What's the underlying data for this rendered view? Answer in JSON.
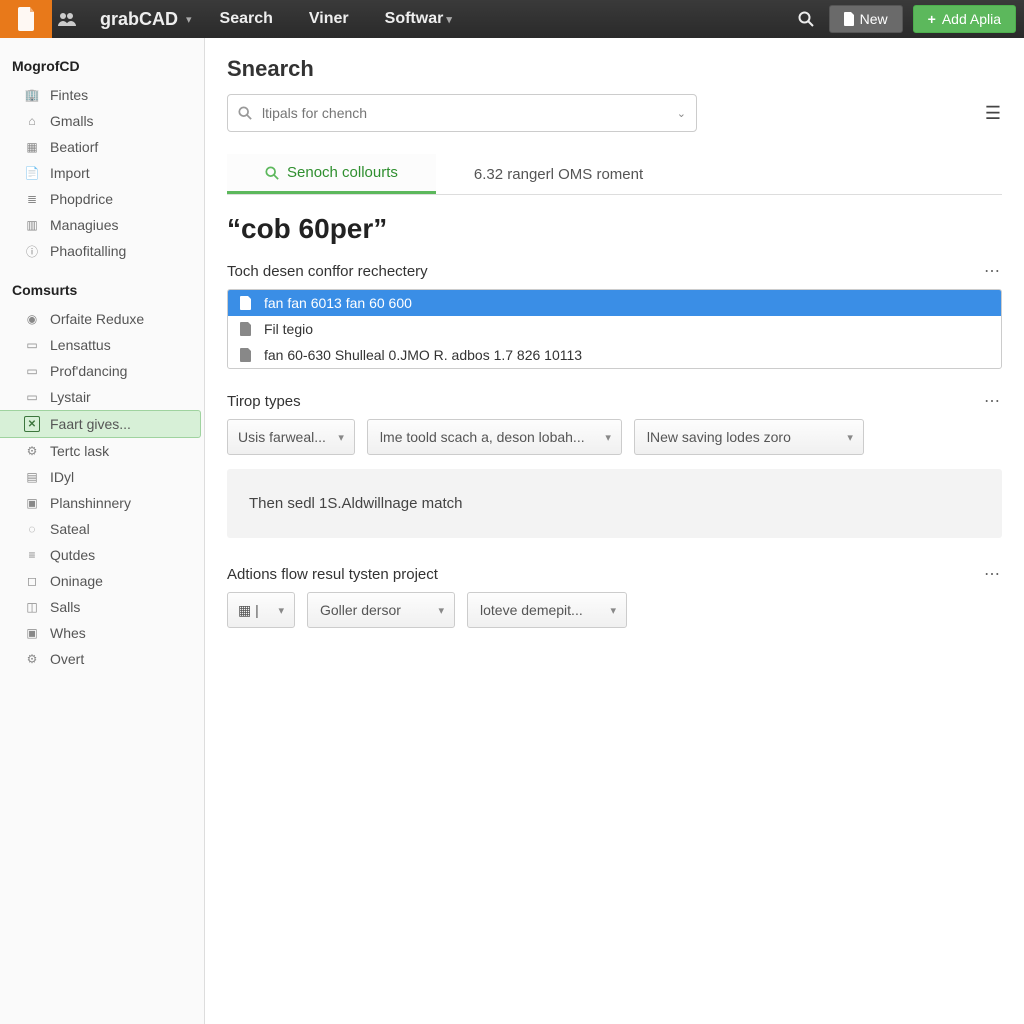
{
  "topbar": {
    "brand": "grabCAD",
    "nav": [
      "Search",
      "Viner",
      "Softwar"
    ],
    "new_label": "New",
    "add_label": "Add Aplia"
  },
  "sidebar": {
    "group1_heading": "MogrofCD",
    "group1": [
      {
        "icon": "building-icon",
        "label": "Fintes"
      },
      {
        "icon": "home-icon",
        "label": "Gmalls"
      },
      {
        "icon": "grid-icon",
        "label": "Beatiorf"
      },
      {
        "icon": "file-icon",
        "label": "Import"
      },
      {
        "icon": "bars-icon",
        "label": "Phopdrice"
      },
      {
        "icon": "column-icon",
        "label": "Managiues"
      },
      {
        "icon": "info-icon",
        "label": "Phaofitalling"
      }
    ],
    "group2_heading": "Comsurts",
    "group2": [
      {
        "icon": "user-icon",
        "label": "Orfaite Reduxe"
      },
      {
        "icon": "folder-icon",
        "label": "Lensattus"
      },
      {
        "icon": "folder-icon",
        "label": "Prof'dancing"
      },
      {
        "icon": "folder-icon",
        "label": "Lystair"
      },
      {
        "icon": "check-icon",
        "label": "Faart gives...",
        "active": true
      },
      {
        "icon": "gear-icon",
        "label": "Tertc lask"
      },
      {
        "icon": "doc-icon",
        "label": "IDyl"
      },
      {
        "icon": "briefcase-icon",
        "label": "Planshinnery"
      },
      {
        "icon": "bulb-icon",
        "label": "Sateal"
      },
      {
        "icon": "list-icon",
        "label": "Qutdes"
      },
      {
        "icon": "box-icon",
        "label": "Oninage"
      },
      {
        "icon": "chart-icon",
        "label": "Salls"
      },
      {
        "icon": "briefcase-icon",
        "label": "Whes"
      },
      {
        "icon": "gear-icon",
        "label": "Overt"
      }
    ]
  },
  "content": {
    "page_title": "Snearch",
    "search_placeholder": "ltipals for chench",
    "tabs": [
      {
        "label": "Senoch collourts",
        "active": true
      },
      {
        "label": "6.32 rangerl OMS roment"
      }
    ],
    "query_heading": "“cob 60per”",
    "section1": {
      "title": "Toch desen conffor rechectery",
      "rows": [
        {
          "label": "fan fan 6013 fan 60 600",
          "selected": true
        },
        {
          "label": "Fil tegio"
        },
        {
          "label": "fan 60-630 Shulleal 0.JMO R. adbos 1.7 826 10113"
        }
      ]
    },
    "section2": {
      "title": "Tirop types",
      "filters": [
        "Usis farweal...",
        "lme toold scach a, deson lobah...",
        "lNew saving lodes zoro"
      ],
      "banner": "Then sedl 1S.Aldwillnage match"
    },
    "section3": {
      "title": "Adtions flow resul tysten project",
      "filters": [
        "▦ |",
        "Goller dersor",
        "loteve demepit..."
      ]
    }
  }
}
